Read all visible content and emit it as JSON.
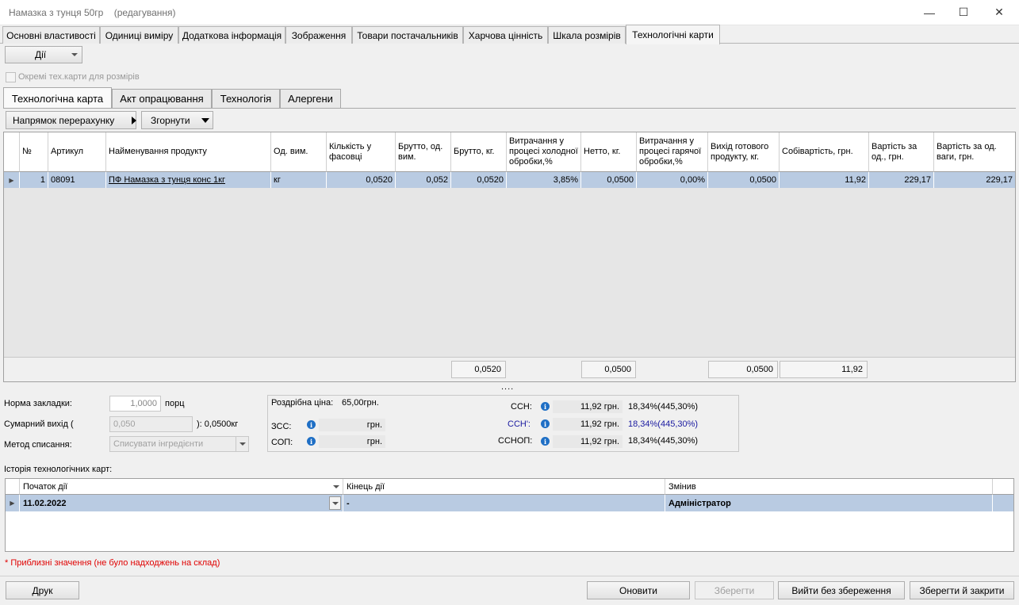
{
  "window": {
    "title": "Намазка з тунця 50гр",
    "title_status": "(редагування)",
    "controls": {
      "minimize": "—",
      "maximize": "☐",
      "close": "✕"
    }
  },
  "top_tabs": [
    {
      "label": "Основні властивості"
    },
    {
      "label": "Одиниці виміру"
    },
    {
      "label": "Додаткова інформація"
    },
    {
      "label": "Зображення"
    },
    {
      "label": "Товари постачальників"
    },
    {
      "label": "Харчова цінність"
    },
    {
      "label": "Шкала розмірів"
    },
    {
      "label": "Технологічні карти",
      "active": true
    }
  ],
  "actions_button": "Дії",
  "separate_cards_checkbox": {
    "label": "Окремі тех.карти для розмірів",
    "checked": false
  },
  "inner_tabs": [
    {
      "label": "Технологічна карта",
      "active": true
    },
    {
      "label": "Акт опрацювання"
    },
    {
      "label": "Технологія"
    },
    {
      "label": "Алергени"
    }
  ],
  "recalc_button": "Напрямок перерахунку",
  "collapse_button": "Згорнути",
  "ingredients_grid": {
    "headers": {
      "num": "№",
      "article": "Артикул",
      "product": "Найменування продукту",
      "unit": "Од. вим.",
      "qty_pack": "Кількість у фасовці",
      "gross_unit": "Брутто, од. вим.",
      "gross_kg": "Брутто, кг.",
      "cold_loss": "Витрачання у процесі холодної обробки,%",
      "net_kg": "Нетто, кг.",
      "hot_loss": "Витрачання у процесі гарячої обробки,%",
      "yield": "Вихід готового продукту, кг.",
      "cost": "Собівартість, грн.",
      "price_unit": "Вартість за од., грн.",
      "price_weight": "Вартість за од. ваги, грн."
    },
    "rows": [
      {
        "num": "1",
        "article": "08091",
        "product": "ПФ Намазка з тунця конс 1кг",
        "unit": "кг",
        "qty_pack": "0,0520",
        "gross_unit": "0,052",
        "gross_kg": "0,0520",
        "cold_loss": "3,85%",
        "net_kg": "0,0500",
        "hot_loss": "0,00%",
        "yield": "0,0500",
        "cost": "11,92",
        "price_unit": "229,17",
        "price_weight": "229,17"
      }
    ],
    "totals": {
      "gross_kg": "0,0520",
      "net_kg": "0,0500",
      "yield": "0,0500",
      "cost": "11,92"
    }
  },
  "splitter": "....",
  "form": {
    "norm_label": "Норма закладки:",
    "norm_value": "1,0000",
    "norm_unit": "порц",
    "total_yield_label": "Сумарний вихід (",
    "total_yield_value": "0,050",
    "total_yield_suffix": "): 0,0500кг",
    "method_label": "Метод списання:",
    "method_value": "Списувати інгредієнти"
  },
  "prices": {
    "retail_label": "Роздрібна ціна:",
    "retail_value": "65,00грн.",
    "zss_label": "ЗСС:",
    "zss_value": "грн.",
    "sop_label": "СОП:",
    "sop_value": "грн.",
    "ssn_label": "ССН:",
    "ssn_value": "11,92 грн.",
    "ssn_pct": "18,34%(445,30%)",
    "ssn2_label": "ССН':",
    "ssn2_value": "11,92 грн.",
    "ssn2_pct": "18,34%(445,30%)",
    "ssnop_label": "ССНОП:",
    "ssnop_value": "11,92 грн.",
    "ssnop_pct": "18,34%(445,30%)"
  },
  "history": {
    "label": "Історія технологічних карт:",
    "headers": {
      "start": "Початок дії",
      "end": "Кінець дії",
      "changed_by": "Змінив"
    },
    "rows": [
      {
        "start": "11.02.2022",
        "end": "-",
        "changed_by": "Адміністратор"
      }
    ]
  },
  "note": "* Приблизні значення (не було надходжень на склад)",
  "bottom_buttons": {
    "print": "Друк",
    "refresh": "Оновити",
    "save": "Зберегти",
    "exit_no_save": "Вийти без збереження",
    "save_close": "Зберегти й закрити"
  },
  "colors": {
    "selected_row": "#b9cbe2",
    "note_red": "#e00000",
    "ssn2_blue": "#1a1aa0",
    "info_icon": "#1f6fc5"
  }
}
